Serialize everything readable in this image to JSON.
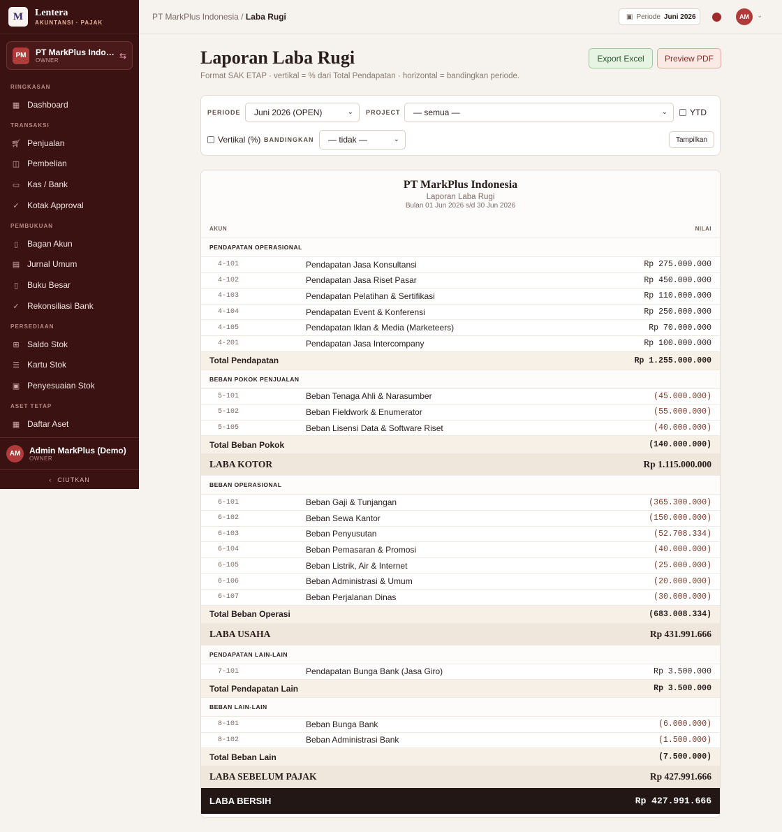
{
  "brand": {
    "logo_letter": "M",
    "name": "Lentera",
    "subtitle": "AKUNTANSI · PAJAK"
  },
  "company": {
    "initials": "PM",
    "name": "PT MarkPlus Indone...",
    "role": "OWNER"
  },
  "nav": {
    "sections": [
      {
        "label": "RINGKASAN",
        "items": [
          {
            "label": "Dashboard",
            "icon": "grid-icon"
          }
        ]
      },
      {
        "label": "TRANSAKSI",
        "items": [
          {
            "label": "Penjualan",
            "icon": "cart-icon"
          },
          {
            "label": "Pembelian",
            "icon": "bag-icon"
          },
          {
            "label": "Kas / Bank",
            "icon": "wallet-icon"
          },
          {
            "label": "Kotak Approval",
            "icon": "check-icon"
          }
        ]
      },
      {
        "label": "PEMBUKUAN",
        "items": [
          {
            "label": "Bagan Akun",
            "icon": "book-icon"
          },
          {
            "label": "Jurnal Umum",
            "icon": "journal-icon"
          },
          {
            "label": "Buku Besar",
            "icon": "ledger-icon"
          },
          {
            "label": "Rekonsiliasi Bank",
            "icon": "check-icon"
          }
        ]
      },
      {
        "label": "PERSEDIAAN",
        "items": [
          {
            "label": "Saldo Stok",
            "icon": "boxes-icon"
          },
          {
            "label": "Kartu Stok",
            "icon": "list-icon"
          },
          {
            "label": "Penyesuaian Stok",
            "icon": "clipboard-icon"
          }
        ]
      },
      {
        "label": "ASET TETAP",
        "items": [
          {
            "label": "Daftar Aset",
            "icon": "building-icon"
          }
        ]
      }
    ]
  },
  "user": {
    "initials": "AM",
    "name": "Admin MarkPlus (Demo)",
    "role": "OWNER"
  },
  "collapse_label": "CIUTKAN",
  "topbar": {
    "breadcrumb_parent": "PT MarkPlus Indonesia",
    "breadcrumb_sep": " / ",
    "breadcrumb_current": "Laba Rugi",
    "period_label": "Periode",
    "period_value": "Juni 2026",
    "avatar_initials": "AM"
  },
  "header": {
    "title": "Laporan Laba Rugi",
    "subtitle": "Format SAK ETAP · vertikal = % dari Total Pendapatan · horizontal = bandingkan periode.",
    "export_excel": "Export Excel",
    "preview_pdf": "Preview PDF"
  },
  "filters": {
    "periode_label": "PERIODE",
    "periode_value": "Juni 2026 (OPEN)",
    "project_label": "PROJECT",
    "project_value": "— semua —",
    "ytd_label": "YTD",
    "vertikal_label": "Vertikal (%)",
    "bandingkan_label": "BANDINGKAN",
    "bandingkan_value": "— tidak —",
    "show_button": "Tampilkan"
  },
  "report": {
    "company": "PT MarkPlus Indonesia",
    "title": "Laporan Laba Rugi",
    "period": "Bulan 01 Jun 2026 s/d 30 Jun 2026",
    "col_account": "AKUN",
    "col_value": "NILAI",
    "sections": [
      {
        "header": "PENDAPATAN OPERASIONAL",
        "rows": [
          {
            "code": "4-101",
            "name": "Pendapatan Jasa Konsultansi",
            "value": "Rp 275.000.000"
          },
          {
            "code": "4-102",
            "name": "Pendapatan Jasa Riset Pasar",
            "value": "Rp 450.000.000"
          },
          {
            "code": "4-103",
            "name": "Pendapatan Pelatihan & Sertifikasi",
            "value": "Rp 110.000.000"
          },
          {
            "code": "4-104",
            "name": "Pendapatan Event & Konferensi",
            "value": "Rp 250.000.000"
          },
          {
            "code": "4-105",
            "name": "Pendapatan Iklan & Media (Marketeers)",
            "value": "Rp 70.000.000"
          },
          {
            "code": "4-201",
            "name": "Pendapatan Jasa Intercompany",
            "value": "Rp 100.000.000"
          }
        ],
        "total_label": "Total Pendapatan",
        "total_value": "Rp 1.255.000.000"
      },
      {
        "header": "BEBAN POKOK PENJUALAN",
        "rows": [
          {
            "code": "5-101",
            "name": "Beban Tenaga Ahli & Narasumber",
            "value": "(45.000.000)"
          },
          {
            "code": "5-102",
            "name": "Beban Fieldwork & Enumerator",
            "value": "(55.000.000)"
          },
          {
            "code": "5-105",
            "name": "Beban Lisensi Data & Software Riset",
            "value": "(40.000.000)"
          }
        ],
        "total_label": "Total Beban Pokok",
        "total_value": "(140.000.000)",
        "summary_label": "LABA KOTOR",
        "summary_value": "Rp 1.115.000.000"
      },
      {
        "header": "BEBAN OPERASIONAL",
        "rows": [
          {
            "code": "6-101",
            "name": "Beban Gaji & Tunjangan",
            "value": "(365.300.000)"
          },
          {
            "code": "6-102",
            "name": "Beban Sewa Kantor",
            "value": "(150.000.000)"
          },
          {
            "code": "6-103",
            "name": "Beban Penyusutan",
            "value": "(52.708.334)"
          },
          {
            "code": "6-104",
            "name": "Beban Pemasaran & Promosi",
            "value": "(40.000.000)"
          },
          {
            "code": "6-105",
            "name": "Beban Listrik, Air & Internet",
            "value": "(25.000.000)"
          },
          {
            "code": "6-106",
            "name": "Beban Administrasi & Umum",
            "value": "(20.000.000)"
          },
          {
            "code": "6-107",
            "name": "Beban Perjalanan Dinas",
            "value": "(30.000.000)"
          }
        ],
        "total_label": "Total Beban Operasi",
        "total_value": "(683.008.334)",
        "summary_label": "LABA USAHA",
        "summary_value": "Rp 431.991.666"
      },
      {
        "header": "PENDAPATAN LAIN-LAIN",
        "rows": [
          {
            "code": "7-101",
            "name": "Pendapatan Bunga Bank (Jasa Giro)",
            "value": "Rp 3.500.000"
          }
        ],
        "total_label": "Total Pendapatan Lain",
        "total_value": "Rp 3.500.000"
      },
      {
        "header": "BEBAN LAIN-LAIN",
        "rows": [
          {
            "code": "8-101",
            "name": "Beban Bunga Bank",
            "value": "(6.000.000)"
          },
          {
            "code": "8-102",
            "name": "Beban Administrasi Bank",
            "value": "(1.500.000)"
          }
        ],
        "total_label": "Total Beban Lain",
        "total_value": "(7.500.000)",
        "summary_label": "LABA SEBELUM PAJAK",
        "summary_value": "Rp 427.991.666"
      }
    ],
    "net_label": "LABA BERSIH",
    "net_value": "Rp 427.991.666"
  }
}
